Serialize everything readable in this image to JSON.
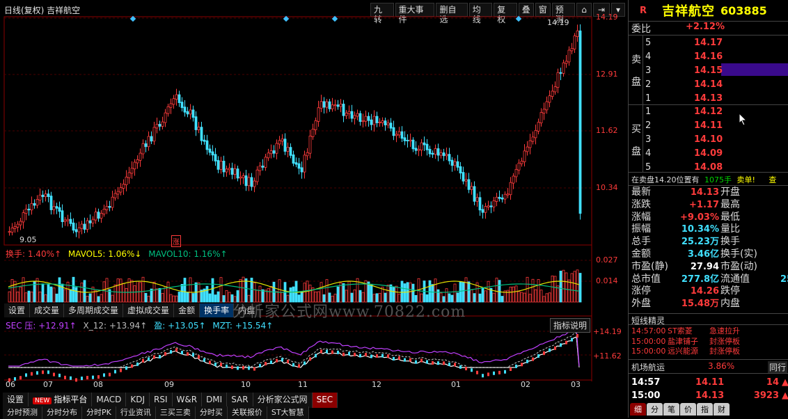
{
  "left": {
    "title": "日线(复权) 吉祥航空",
    "toolbar": [
      "九转",
      "重大事件",
      "删自选",
      "均线",
      "复权",
      "叠",
      "窗",
      "预测"
    ],
    "price_axis": [
      "14.19",
      "12.91",
      "11.62",
      "10.34"
    ],
    "hi_label": "14.19",
    "lo_label": "9.05",
    "zhang_marker": "涨",
    "vol_title_1": "换手: 1.40%↑",
    "vol_title_2": "MAVOL5: 1.06%↓",
    "vol_title_3": "MAVOL10: 1.16%↑",
    "vol_axis": [
      "0.027",
      "0.014"
    ],
    "vol_tabs": [
      "设置",
      "成交量",
      "多周期成交量",
      "虚拟成交量",
      "金额",
      "换手率",
      "内盘"
    ],
    "watermark": "分析家公式网www.70822.com",
    "sec_title": [
      "SEC 压: +12.91↑",
      "X_12: +13.94↑",
      "盈: +13.05↑",
      "MZT: +15.54↑"
    ],
    "sec_btn": "指标说明",
    "sec_axis": [
      "+14.19",
      "+11.62"
    ],
    "months": [
      "06",
      "07",
      "08",
      "09",
      "10",
      "11",
      "12",
      "01",
      "02",
      "03"
    ],
    "bottom_tabs": [
      "设置",
      "指标平台",
      "MACD",
      "KDJ",
      "RSI",
      "W&R",
      "DMI",
      "SAR",
      "分析家公式网",
      "SEC"
    ],
    "bottom_new_badge": "NEW",
    "bottom_row2": [
      "分时预测",
      "分时分布",
      "分时PK",
      "行业资讯",
      "三买三卖",
      "分时买",
      "关联报价",
      "ST大智慧"
    ]
  },
  "right": {
    "r_mark": "R",
    "name": "吉祥航空",
    "code": "603885",
    "weibi_label": "委比",
    "weibi_value": "+2.12%",
    "sell_label": [
      "卖",
      "盘"
    ],
    "buy_label": [
      "买",
      "盘"
    ],
    "sell": [
      {
        "lvl": "5",
        "price": "14.17"
      },
      {
        "lvl": "4",
        "price": "14.16"
      },
      {
        "lvl": "3",
        "price": "14.15"
      },
      {
        "lvl": "2",
        "price": "14.14"
      },
      {
        "lvl": "1",
        "price": "14.13"
      }
    ],
    "buy": [
      {
        "lvl": "1",
        "price": "14.12"
      },
      {
        "lvl": "2",
        "price": "14.11"
      },
      {
        "lvl": "3",
        "price": "14.10"
      },
      {
        "lvl": "4",
        "price": "14.09"
      },
      {
        "lvl": "5",
        "price": "14.08"
      }
    ],
    "notice_a": "在卖盘14.20位置有",
    "notice_b": "1075手",
    "notice_c": "卖单!",
    "notice_d": "查",
    "stats": [
      {
        "l": "最新",
        "v": "14.13",
        "c": "red",
        "r": "开盘"
      },
      {
        "l": "涨跌",
        "v": "+1.17",
        "c": "red",
        "r": "最高"
      },
      {
        "l": "涨幅",
        "v": "+9.03%",
        "c": "red",
        "r": "最低"
      },
      {
        "l": "振幅",
        "v": "10.34%",
        "c": "cyan",
        "r": "量比"
      },
      {
        "l": "总手",
        "v": "25.23万",
        "c": "cyan",
        "r": "换手"
      },
      {
        "l": "金额",
        "v": "3.46亿",
        "c": "cyan",
        "r": "换手(实)"
      },
      {
        "l": "市盈(静)",
        "v": "27.94",
        "c": "white",
        "r": "市盈(动)"
      },
      {
        "l": "总市值",
        "v": "277.8亿",
        "c": "cyan",
        "r": "流通值"
      },
      {
        "l": "涨停",
        "v": "14.26",
        "c": "red",
        "r": "跌停"
      },
      {
        "l": "外盘",
        "v": "15.48万",
        "c": "red",
        "r": "内盘"
      }
    ],
    "liutong_partial": "25",
    "elf_title": "短线精灵",
    "elf": [
      {
        "t": "14:57:00",
        "n": "ST索菱",
        "e": "急速拉升"
      },
      {
        "t": "15:00:00",
        "n": "盐津铺子",
        "e": "封涨停板"
      },
      {
        "t": "15:00:00",
        "n": "远兴能源",
        "e": "封涨停板"
      }
    ],
    "sector": {
      "name": "机场航运",
      "pct": "3.86%",
      "btn": "同行"
    },
    "ticks": [
      {
        "t": "14:57",
        "p": "14.11",
        "v": "14"
      },
      {
        "t": "15:00",
        "p": "14.13",
        "v": "3923"
      }
    ],
    "btabs": [
      "细",
      "分",
      "笔",
      "价",
      "指",
      "财"
    ]
  }
}
